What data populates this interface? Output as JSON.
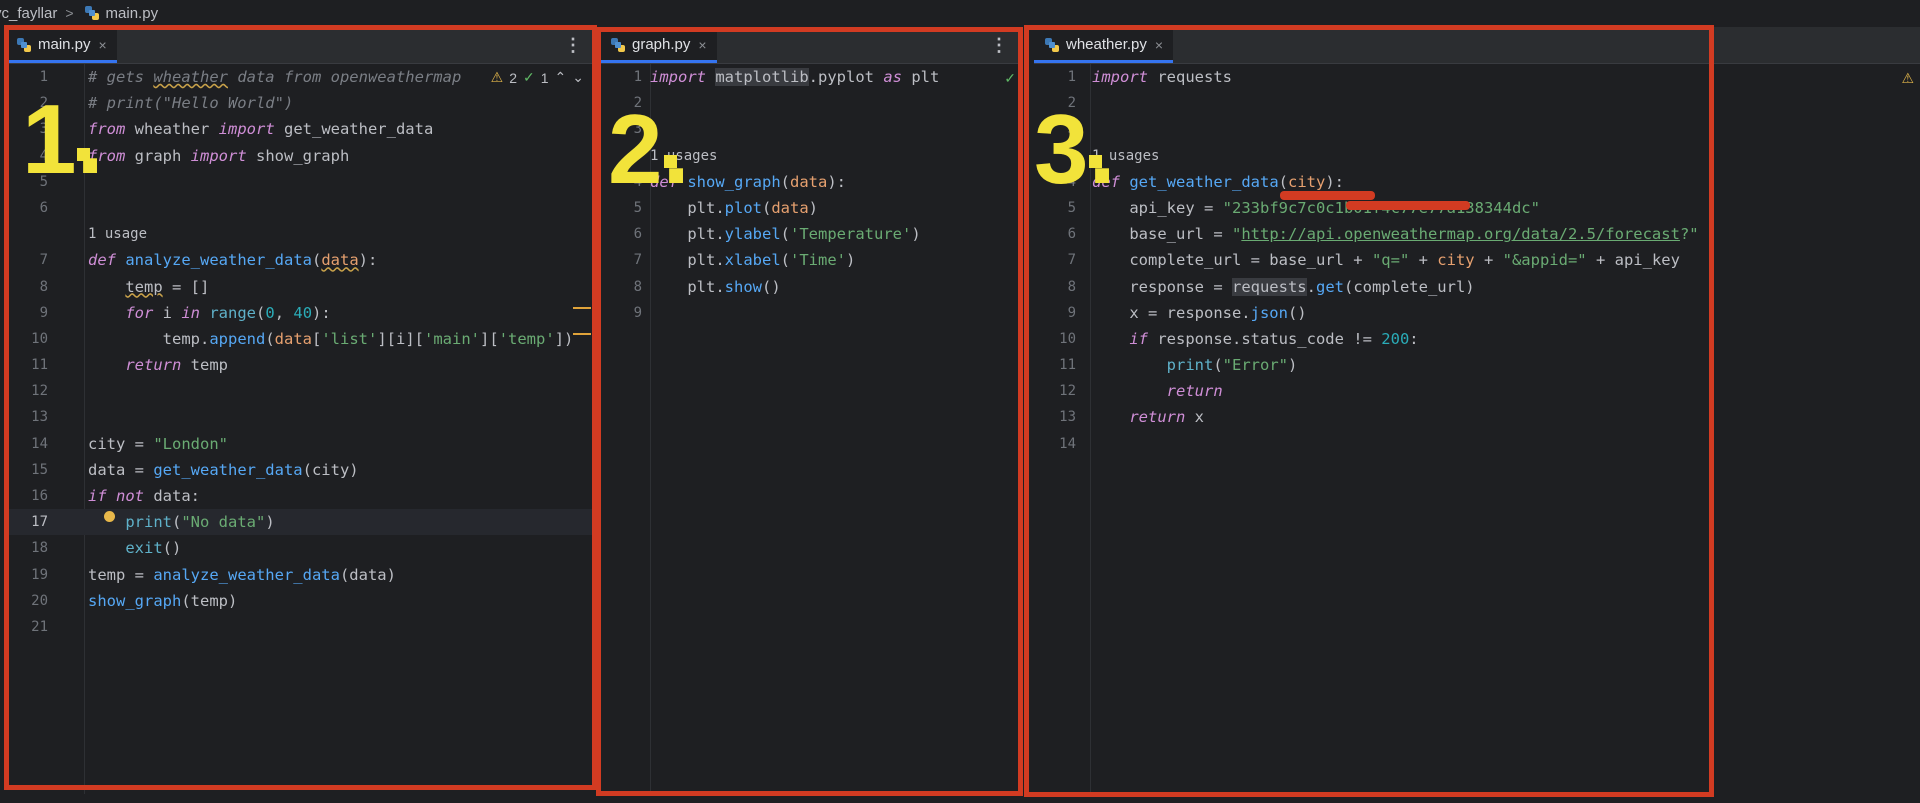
{
  "breadcrumb": {
    "folder": "yc_fayllar",
    "file": "main.py"
  },
  "panes": [
    {
      "tab": "main.py",
      "label": "1.",
      "inspections": {
        "warnings": "2",
        "ok": "1"
      },
      "lines": [
        {
          "n": "1",
          "html": "<span class=\"c\"># gets <span class=\"squig\">wheather</span> data from openweathermap</span>"
        },
        {
          "n": "2",
          "html": "<span class=\"c\"># print(\"Hello World\")</span>"
        },
        {
          "n": "3",
          "html": "<span class=\"k\">from</span> wheather <span class=\"k\">import</span> get_weather_data"
        },
        {
          "n": "4",
          "html": "<span class=\"k\">from</span> graph <span class=\"k\">import</span> show_graph"
        },
        {
          "n": "5",
          "html": ""
        },
        {
          "n": "6",
          "html": ""
        },
        {
          "n": "",
          "hint": "1 usage"
        },
        {
          "n": "7",
          "html": "<span class=\"k\">def</span> <span class=\"f\">analyze_weather_data</span>(<span class=\"p squig\">data</span>):"
        },
        {
          "n": "8",
          "html": "    <span class=\"squig\">temp</span> = []"
        },
        {
          "n": "9",
          "html": "    <span class=\"k\">for</span> i <span class=\"k\">in</span> <span class=\"b\">range</span>(<span class=\"n\">0</span>, <span class=\"n\">40</span>):"
        },
        {
          "n": "10",
          "html": "        temp.<span class=\"f\">append</span>(<span class=\"p\">data</span>[<span class=\"s\">'list'</span>][i][<span class=\"s\">'main'</span>][<span class=\"s\">'temp'</span>])"
        },
        {
          "n": "11",
          "html": "    <span class=\"k\">return</span> temp"
        },
        {
          "n": "12",
          "html": ""
        },
        {
          "n": "13",
          "html": ""
        },
        {
          "n": "14",
          "html": "city = <span class=\"s\">\"London\"</span>"
        },
        {
          "n": "15",
          "html": "data = <span class=\"f\">get_weather_data</span>(city)"
        },
        {
          "n": "16",
          "html": "<span class=\"k\">if</span> <span class=\"k\">not</span> data:"
        },
        {
          "n": "17",
          "html": "    <span class=\"b\">print</span>(<span class=\"s\">\"No data\"</span>)",
          "current": true
        },
        {
          "n": "18",
          "html": "    <span class=\"b\">exit</span>()"
        },
        {
          "n": "19",
          "html": "temp = <span class=\"f\">analyze_weather_data</span>(data)"
        },
        {
          "n": "20",
          "html": "<span class=\"f\">show_graph</span>(temp)"
        },
        {
          "n": "21",
          "html": ""
        }
      ]
    },
    {
      "tab": "graph.py",
      "label": "2.",
      "lines": [
        {
          "n": "1",
          "html": "<span class=\"k\">import</span> <span class=\"mod\">matplotlib</span>.pyplot <span class=\"k\">as</span> plt"
        },
        {
          "n": "2",
          "html": ""
        },
        {
          "n": "3",
          "html": ""
        },
        {
          "n": "",
          "hint": "1 usages"
        },
        {
          "n": "4",
          "html": "<span class=\"k\">def</span> <span class=\"f\">show_graph</span>(<span class=\"p\">data</span>):"
        },
        {
          "n": "5",
          "html": "    plt.<span class=\"f\">plot</span>(<span class=\"p\">data</span>)"
        },
        {
          "n": "6",
          "html": "    plt.<span class=\"f\">ylabel</span>(<span class=\"s\">'Temperature'</span>)"
        },
        {
          "n": "7",
          "html": "    plt.<span class=\"f\">xlabel</span>(<span class=\"s\">'Time'</span>)"
        },
        {
          "n": "8",
          "html": "    plt.<span class=\"f\">show</span>()"
        },
        {
          "n": "9",
          "html": ""
        }
      ]
    },
    {
      "tab": "wheather.py",
      "label": "3.",
      "lines": [
        {
          "n": "1",
          "html": "<span class=\"k\">import</span> requests"
        },
        {
          "n": "2",
          "html": ""
        },
        {
          "n": "3",
          "html": ""
        },
        {
          "n": "",
          "hint": "1 usages"
        },
        {
          "n": "4",
          "html": "<span class=\"k\">def</span> <span class=\"f\">get_weather_data</span>(<span class=\"p\">city</span>):"
        },
        {
          "n": "5",
          "html": "    api_key = <span class=\"s\">\"233bf9c7c0c1b01f4c77e77a138344dc\"</span>"
        },
        {
          "n": "6",
          "html": "    base_url = <span class=\"s\">\"<span class=\"u\">http://api.openweathermap.org/data/2.5/forecast</span>?\"</span>"
        },
        {
          "n": "7",
          "html": "    complete_url = base_url + <span class=\"s\">\"q=\"</span> + <span class=\"p\">city</span> + <span class=\"s\">\"&amp;appid=\"</span> + api_key"
        },
        {
          "n": "8",
          "html": "    response = <span class=\"mod\">requests</span>.<span class=\"f\">get</span>(complete_url)"
        },
        {
          "n": "9",
          "html": "    x = response.<span class=\"f\">json</span>()"
        },
        {
          "n": "10",
          "html": "    <span class=\"k\">if</span> response.status_code != <span class=\"n\">200</span>:"
        },
        {
          "n": "11",
          "html": "        <span class=\"b\">print</span>(<span class=\"s\">\"Error\"</span>)"
        },
        {
          "n": "12",
          "html": "        <span class=\"k\">return</span>"
        },
        {
          "n": "13",
          "html": "    <span class=\"k\">return</span> x"
        },
        {
          "n": "14",
          "html": ""
        }
      ]
    }
  ],
  "icons": {
    "tab_close": "×",
    "more": "⋮",
    "up": "⌃",
    "down": "⌄",
    "warning": "⚠",
    "check": "✓",
    "chevron": ">"
  }
}
